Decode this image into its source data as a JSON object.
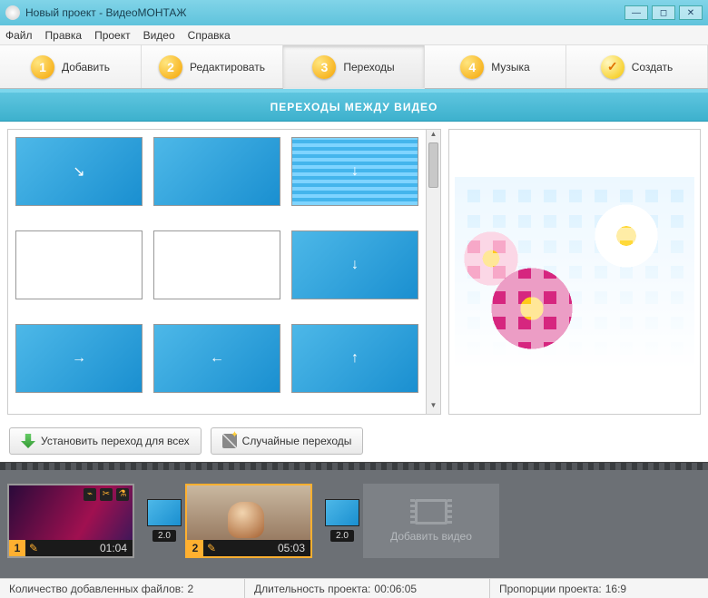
{
  "window": {
    "title": "Новый проект - ВидеоМОНТАЖ"
  },
  "menu": {
    "file": "Файл",
    "edit": "Правка",
    "project": "Проект",
    "video": "Видео",
    "help": "Справка"
  },
  "steps": {
    "s1": {
      "num": "1",
      "label": "Добавить"
    },
    "s2": {
      "num": "2",
      "label": "Редактировать"
    },
    "s3": {
      "num": "3",
      "label": "Переходы"
    },
    "s4": {
      "num": "4",
      "label": "Музыка"
    },
    "s5": {
      "label": "Создать"
    }
  },
  "header": {
    "title": "ПЕРЕХОДЫ МЕЖДУ ВИДЕО"
  },
  "actions": {
    "apply_all": "Установить переход для всех",
    "random": "Случайные переходы"
  },
  "timeline": {
    "clip1": {
      "index": "1",
      "duration": "01:04"
    },
    "trans1": {
      "duration": "2.0"
    },
    "clip2": {
      "index": "2",
      "duration": "05:03"
    },
    "trans2": {
      "duration": "2.0"
    },
    "add_label": "Добавить видео"
  },
  "status": {
    "files_label": "Количество добавленных файлов:",
    "files_value": "2",
    "duration_label": "Длительность проекта:",
    "duration_value": "00:06:05",
    "aspect_label": "Пропорции проекта:",
    "aspect_value": "16:9"
  }
}
